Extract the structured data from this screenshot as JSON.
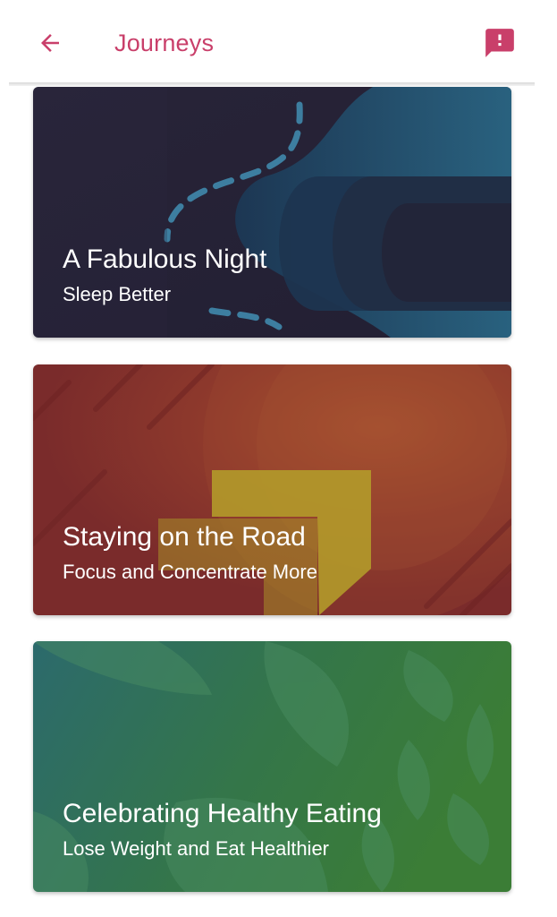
{
  "header": {
    "title": "Journeys",
    "back_icon": "arrow-left-icon",
    "report_icon": "feedback-icon",
    "accent_color": "#c93f6a"
  },
  "journeys": [
    {
      "title": "A Fabulous Night",
      "subtitle": "Sleep Better",
      "theme": "night",
      "colors": [
        "#262237",
        "#1e3f5c",
        "#2b6e8a"
      ]
    },
    {
      "title": "Staying on the Road",
      "subtitle": "Focus and Concentrate More",
      "theme": "road",
      "colors": [
        "#7d2a2a",
        "#a3472f",
        "#9e8a2a"
      ]
    },
    {
      "title": "Celebrating Healthy Eating",
      "subtitle": "Lose Weight and Eat Healthier",
      "theme": "eating",
      "colors": [
        "#2e6e6e",
        "#3a7d3e",
        "#4b8a4e"
      ]
    }
  ]
}
